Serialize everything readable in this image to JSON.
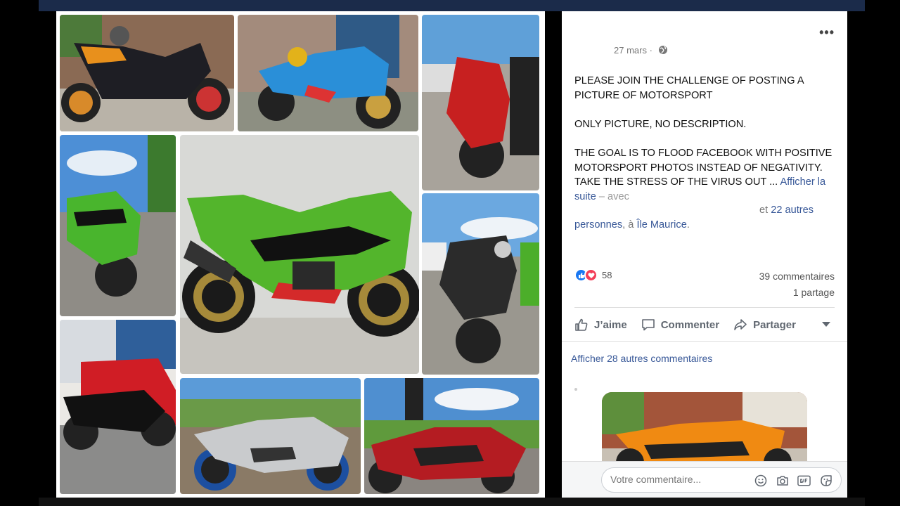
{
  "post": {
    "date": "27 mars ·",
    "text_p1": "PLEASE JOIN THE CHALLENGE OF POSTING A PICTURE OF MOTORSPORT",
    "text_p2": "ONLY PICTURE, NO DESCRIPTION.",
    "text_p3": "THE GOAL IS TO FLOOD FACEBOOK WITH POSITIVE MOTORSPORT PHOTOS INSTEAD OF NEGATIVITY. TAKE THE STRESS OF THE VIRUS OUT",
    "ellipsis": " ... ",
    "see_more": "Afficher la suite",
    "with": " – avec",
    "tag_and": "et ",
    "tag_others": "22 autres",
    "tag_people": "personnes",
    "tag_at": ", à ",
    "tag_place": "Île Maurice",
    "tag_end": "."
  },
  "stats": {
    "reactions_count": "58",
    "comments": "39 commentaires",
    "shares": "1 partage"
  },
  "actions": {
    "like": "J’aime",
    "comment": "Commenter",
    "share": "Partager"
  },
  "comments": {
    "more": "Afficher 28 autres commentaires",
    "input_placeholder": "Votre commentaire..."
  },
  "icons": {
    "globe": "globe-icon",
    "like": "thumbs-up-icon",
    "love": "heart-icon",
    "comment": "speech-bubble-icon",
    "share": "share-arrow-icon",
    "caret": "caret-down-icon",
    "emoji": "smiley-icon",
    "camera": "camera-icon",
    "gif": "gif-icon",
    "sticker": "sticker-icon"
  },
  "colors": {
    "link": "#385898",
    "like_blue": "#1877f2",
    "love_red": "#f33e58"
  }
}
